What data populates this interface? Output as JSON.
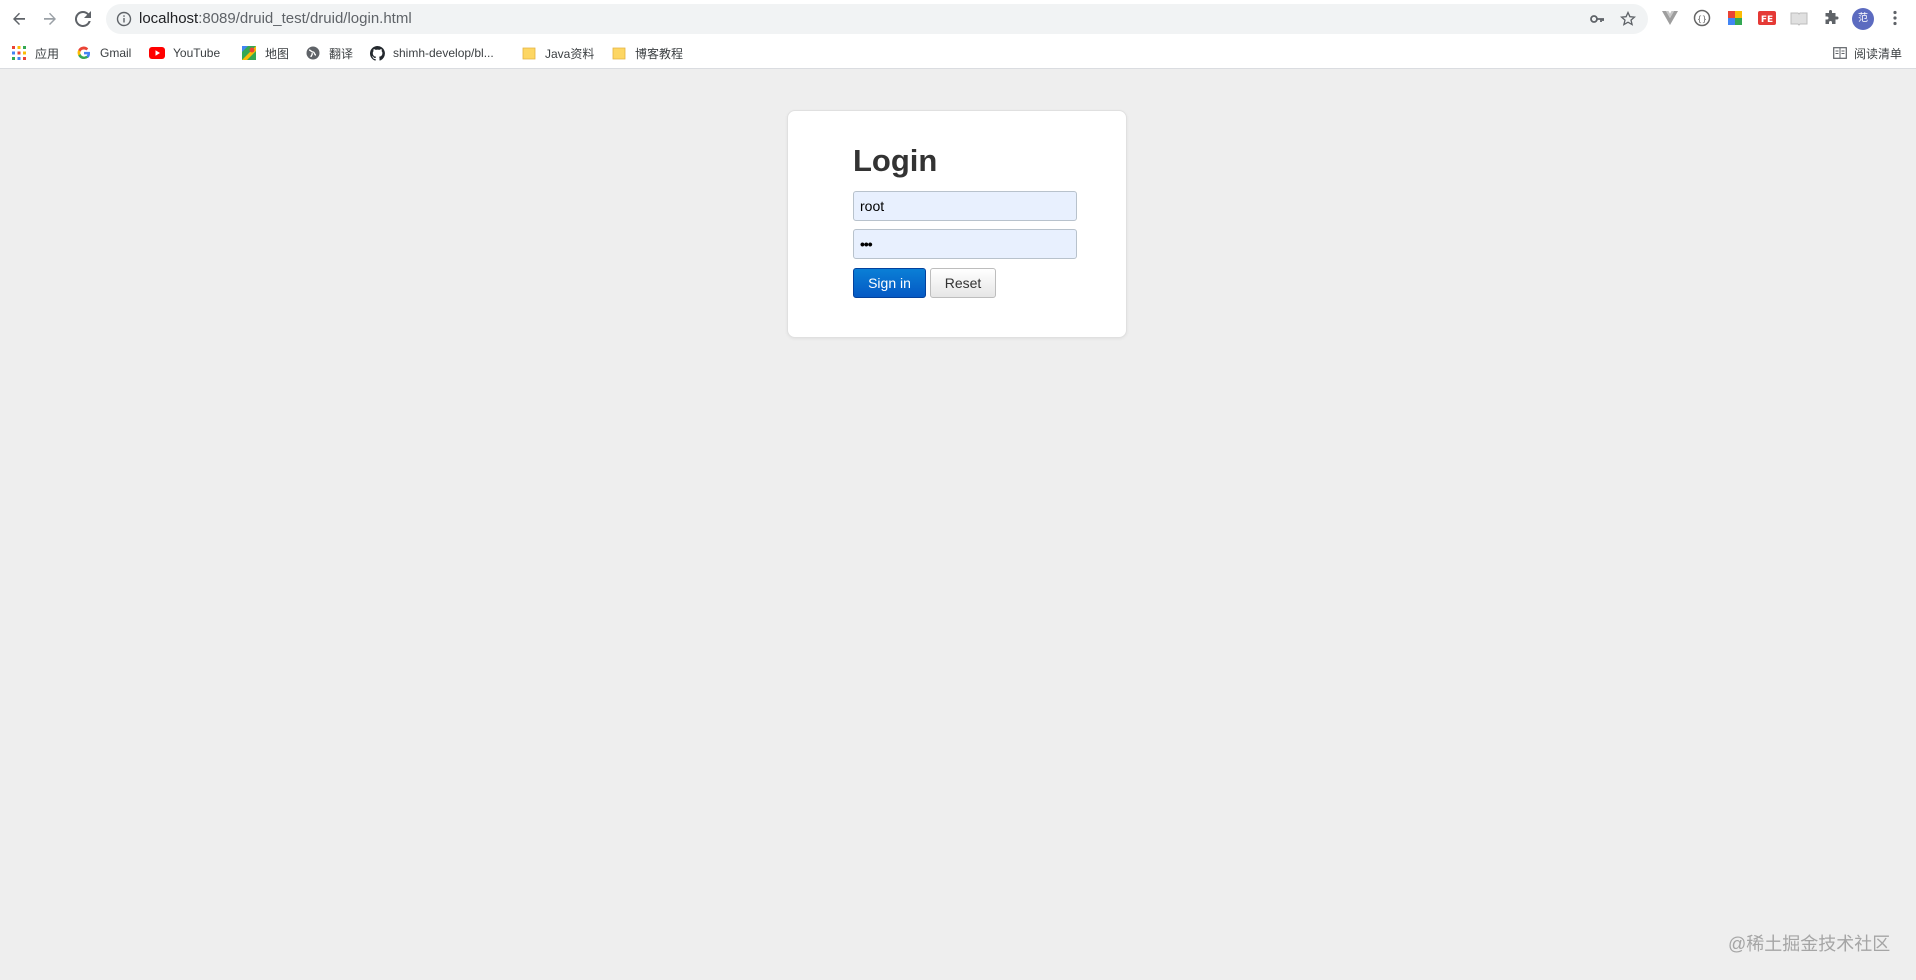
{
  "browser": {
    "url_host": "localhost",
    "url_rest": ":8089/druid_test/druid/login.html",
    "avatar_label": "范",
    "bookmarks": [
      {
        "label": "应用",
        "icon": "apps-grid-icon"
      },
      {
        "label": "Gmail",
        "icon": "google-icon"
      },
      {
        "label": "YouTube",
        "icon": "youtube-icon"
      },
      {
        "label": "地图",
        "icon": "maps-icon"
      },
      {
        "label": "翻译",
        "icon": "globe-icon"
      },
      {
        "label": "shimh-develop/bl...",
        "icon": "github-icon"
      },
      {
        "label": "Java资料",
        "icon": "folder-icon"
      },
      {
        "label": "博客教程",
        "icon": "folder-icon"
      }
    ],
    "reading_list": "阅读清单"
  },
  "login": {
    "title": "Login",
    "username_value": "root",
    "password_value": "•••",
    "signin_label": "Sign in",
    "reset_label": "Reset"
  },
  "watermark": "@稀土掘金技术社区",
  "colors": {
    "page_bg": "#eeeeee",
    "primary_button": "#0563c8",
    "input_bg": "#e8f0fe"
  }
}
